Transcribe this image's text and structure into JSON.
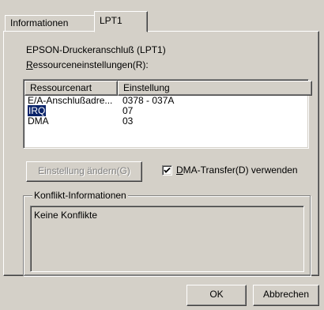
{
  "tabs": [
    {
      "label": "Informationen"
    },
    {
      "label": "LPT1"
    }
  ],
  "port_title": "EPSON-Druckeranschluß (LPT1)",
  "resource_settings": {
    "mnemonic": "R",
    "label_rest": "essourceneinstellungen(R):"
  },
  "list": {
    "headers": [
      "Ressourcenart",
      "Einstellung"
    ],
    "rows": [
      {
        "type": "E/A-Anschlußadre...",
        "setting": "0378 - 037A"
      },
      {
        "type": "IRQ",
        "setting": "07",
        "selected": true
      },
      {
        "type": "DMA",
        "setting": "03"
      }
    ]
  },
  "change_button": {
    "mnemonic": "",
    "label": "Einstellung ändern(G)"
  },
  "dma_checkbox": {
    "checked": true,
    "mnemonic": "D",
    "label_rest": "MA-Transfer(D) verwenden"
  },
  "conflict": {
    "legend": "Konflikt-Informationen",
    "text": "Keine Konflikte"
  },
  "buttons": {
    "ok": "OK",
    "cancel": "Abbrechen"
  }
}
